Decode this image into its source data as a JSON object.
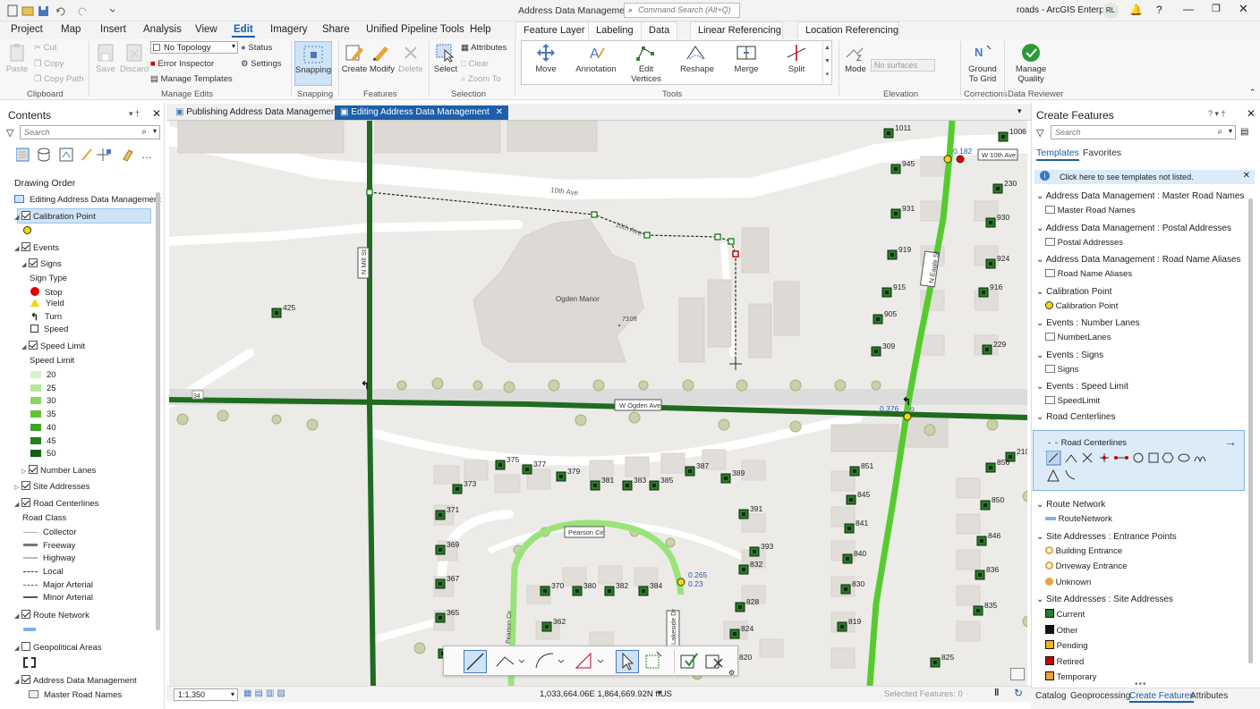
{
  "title": {
    "app": "Address Data Management",
    "search_placeholder": "Command Search (Alt+Q)",
    "portal": "roads - ArcGIS Enterprise",
    "avatar": "RL",
    "help": "?"
  },
  "menu": [
    "Project",
    "Map",
    "Insert",
    "Analysis",
    "View",
    "Edit",
    "Imagery",
    "Share",
    "Unified Pipeline Tools",
    "Help"
  ],
  "context_tabs": [
    "Feature Layer",
    "Labeling",
    "Data",
    "Linear Referencing",
    "Location Referencing"
  ],
  "ribbon": {
    "clipboard": {
      "paste": "Paste",
      "cut": "Cut",
      "copy": "Copy",
      "copy_path": "Copy Path",
      "group": "Clipboard"
    },
    "manage_edits": {
      "save": "Save",
      "discard": "Discard",
      "topology": "No Topology",
      "status": "Status",
      "error_inspector": "Error Inspector",
      "settings": "Settings",
      "manage_templates": "Manage Templates",
      "group": "Manage Edits"
    },
    "snapping": {
      "label": "Snapping",
      "group": "Snapping"
    },
    "features": {
      "create": "Create",
      "modify": "Modify",
      "delete": "Delete",
      "group": "Features"
    },
    "selection": {
      "select": "Select",
      "attributes": "Attributes",
      "clear": "Clear",
      "zoom_to": "Zoom To",
      "group": "Selection"
    },
    "tools": {
      "move": "Move",
      "annotation": "Annotation",
      "edit_vertices_1": "Edit",
      "edit_vertices_2": "Vertices",
      "reshape": "Reshape",
      "merge": "Merge",
      "split": "Split",
      "group": "Tools"
    },
    "elevation": {
      "mode": "Mode",
      "surfaces": "No surfaces",
      "group": "Elevation"
    },
    "corrections": {
      "ground_1": "Ground",
      "ground_2": "To Grid",
      "group": "Corrections"
    },
    "reviewer": {
      "manage_1": "Manage",
      "manage_2": "Quality",
      "group": "Data Reviewer"
    }
  },
  "contents": {
    "title": "Contents",
    "search": "Search",
    "drawing_order": "Drawing Order",
    "map_name": "Editing Address Data Management",
    "calibration": "Calibration Point",
    "events": "Events",
    "signs": "Signs",
    "sign_type": "Sign Type",
    "sign_types": [
      "Stop",
      "Yield",
      "Turn",
      "Speed"
    ],
    "speed_limit": "Speed Limit",
    "speed_limit_sub": "Speed Limit",
    "speeds": [
      "20",
      "25",
      "30",
      "35",
      "40",
      "45",
      "50"
    ],
    "number_lanes": "Number Lanes",
    "site_addresses": "Site Addresses",
    "road_centerlines": "Road Centerlines",
    "road_class": "Road Class",
    "road_classes": [
      "Collector",
      "Freeway",
      "Highway",
      "Local",
      "Major Arterial",
      "Minor Arterial"
    ],
    "route_network": "Route Network",
    "geopolitical": "Geopolitical Areas",
    "adm": "Address Data Management",
    "master_road": "Master Road Names"
  },
  "map_tabs": [
    "Publishing Address Data Management",
    "Editing Address Data Management"
  ],
  "map": {
    "labels": {
      "tenth": "10th Ave",
      "tenth_b": "10th Ave",
      "w_tenth": "W 10th Ave",
      "ogden_manor": "Ogden Manor",
      "elev": "710ft",
      "w_ogden": "W Ogden Ave",
      "n_mill": "N Mill St",
      "n_eagle": "N Eagle St",
      "pearson": "Pearson Cir",
      "pearson_v": "Pearson Cir",
      "lakeside": "Lakeside Dr",
      "route34": "34"
    },
    "measures": {
      "m1": "0.182",
      "m2": "0.376",
      "m3": "0.265",
      "m4": "0.23"
    },
    "addresses_left": [
      "425",
      "375",
      "377",
      "373",
      "379",
      "381",
      "383",
      "385",
      "387",
      "389",
      "371",
      "369",
      "367",
      "365",
      "363",
      "370",
      "380",
      "382",
      "384",
      "362",
      "391",
      "393",
      "832",
      "828",
      "824",
      "820"
    ],
    "addresses_right": [
      "1011",
      "1006",
      "945",
      "230",
      "931",
      "930",
      "919",
      "924",
      "915",
      "916",
      "905",
      "309",
      "229",
      "210",
      "851",
      "856",
      "845",
      "850",
      "841",
      "846",
      "840",
      "836",
      "830",
      "835",
      "819",
      "825"
    ],
    "scale": "1:1,350",
    "coords": "1,033,664.06E 1,864,669.92N ftUS",
    "selected": "Selected Features: 0"
  },
  "create_features": {
    "title": "Create Features",
    "search": "Search",
    "tabs": [
      "Templates",
      "Favorites"
    ],
    "notice": "Click here to see templates not listed.",
    "groups": [
      {
        "header": "Address Data Management : Master Road Names",
        "items": [
          "Master Road Names"
        ]
      },
      {
        "header": "Address Data Management : Postal Addresses",
        "items": [
          "Postal Addresses"
        ]
      },
      {
        "header": "Address Data Management : Road Name Aliases",
        "items": [
          "Road Name Aliases"
        ]
      },
      {
        "header": "Calibration Point",
        "items": [
          "Calibration Point"
        ]
      },
      {
        "header": "Events : Number Lanes",
        "items": [
          "NumberLanes"
        ]
      },
      {
        "header": "Events : Signs",
        "items": [
          "Signs"
        ]
      },
      {
        "header": "Events : Speed Limit",
        "items": [
          "SpeedLimit"
        ]
      }
    ],
    "road_centerlines_header": "Road Centerlines",
    "road_centerlines_item": "Road Centerlines",
    "groups2": [
      {
        "header": "Route Network",
        "items": [
          "RouteNetwork"
        ]
      },
      {
        "header": "Site Addresses : Entrance Points",
        "items": [
          "Building Entrance",
          "Driveway Entrance",
          "Unknown"
        ]
      },
      {
        "header": "Site Addresses : Site Addresses",
        "items": [
          "Current",
          "Other",
          "Pending",
          "Retired",
          "Temporary"
        ]
      }
    ]
  },
  "bottom_tabs": [
    "Catalog",
    "Geoprocessing",
    "Create Features",
    "Attributes"
  ],
  "colors": {
    "accent": "#1d5fa8",
    "road_dark": "#1f6b1f",
    "road_light": "#5dd13a",
    "stop": "#e00000",
    "yield": "#f5d800"
  }
}
